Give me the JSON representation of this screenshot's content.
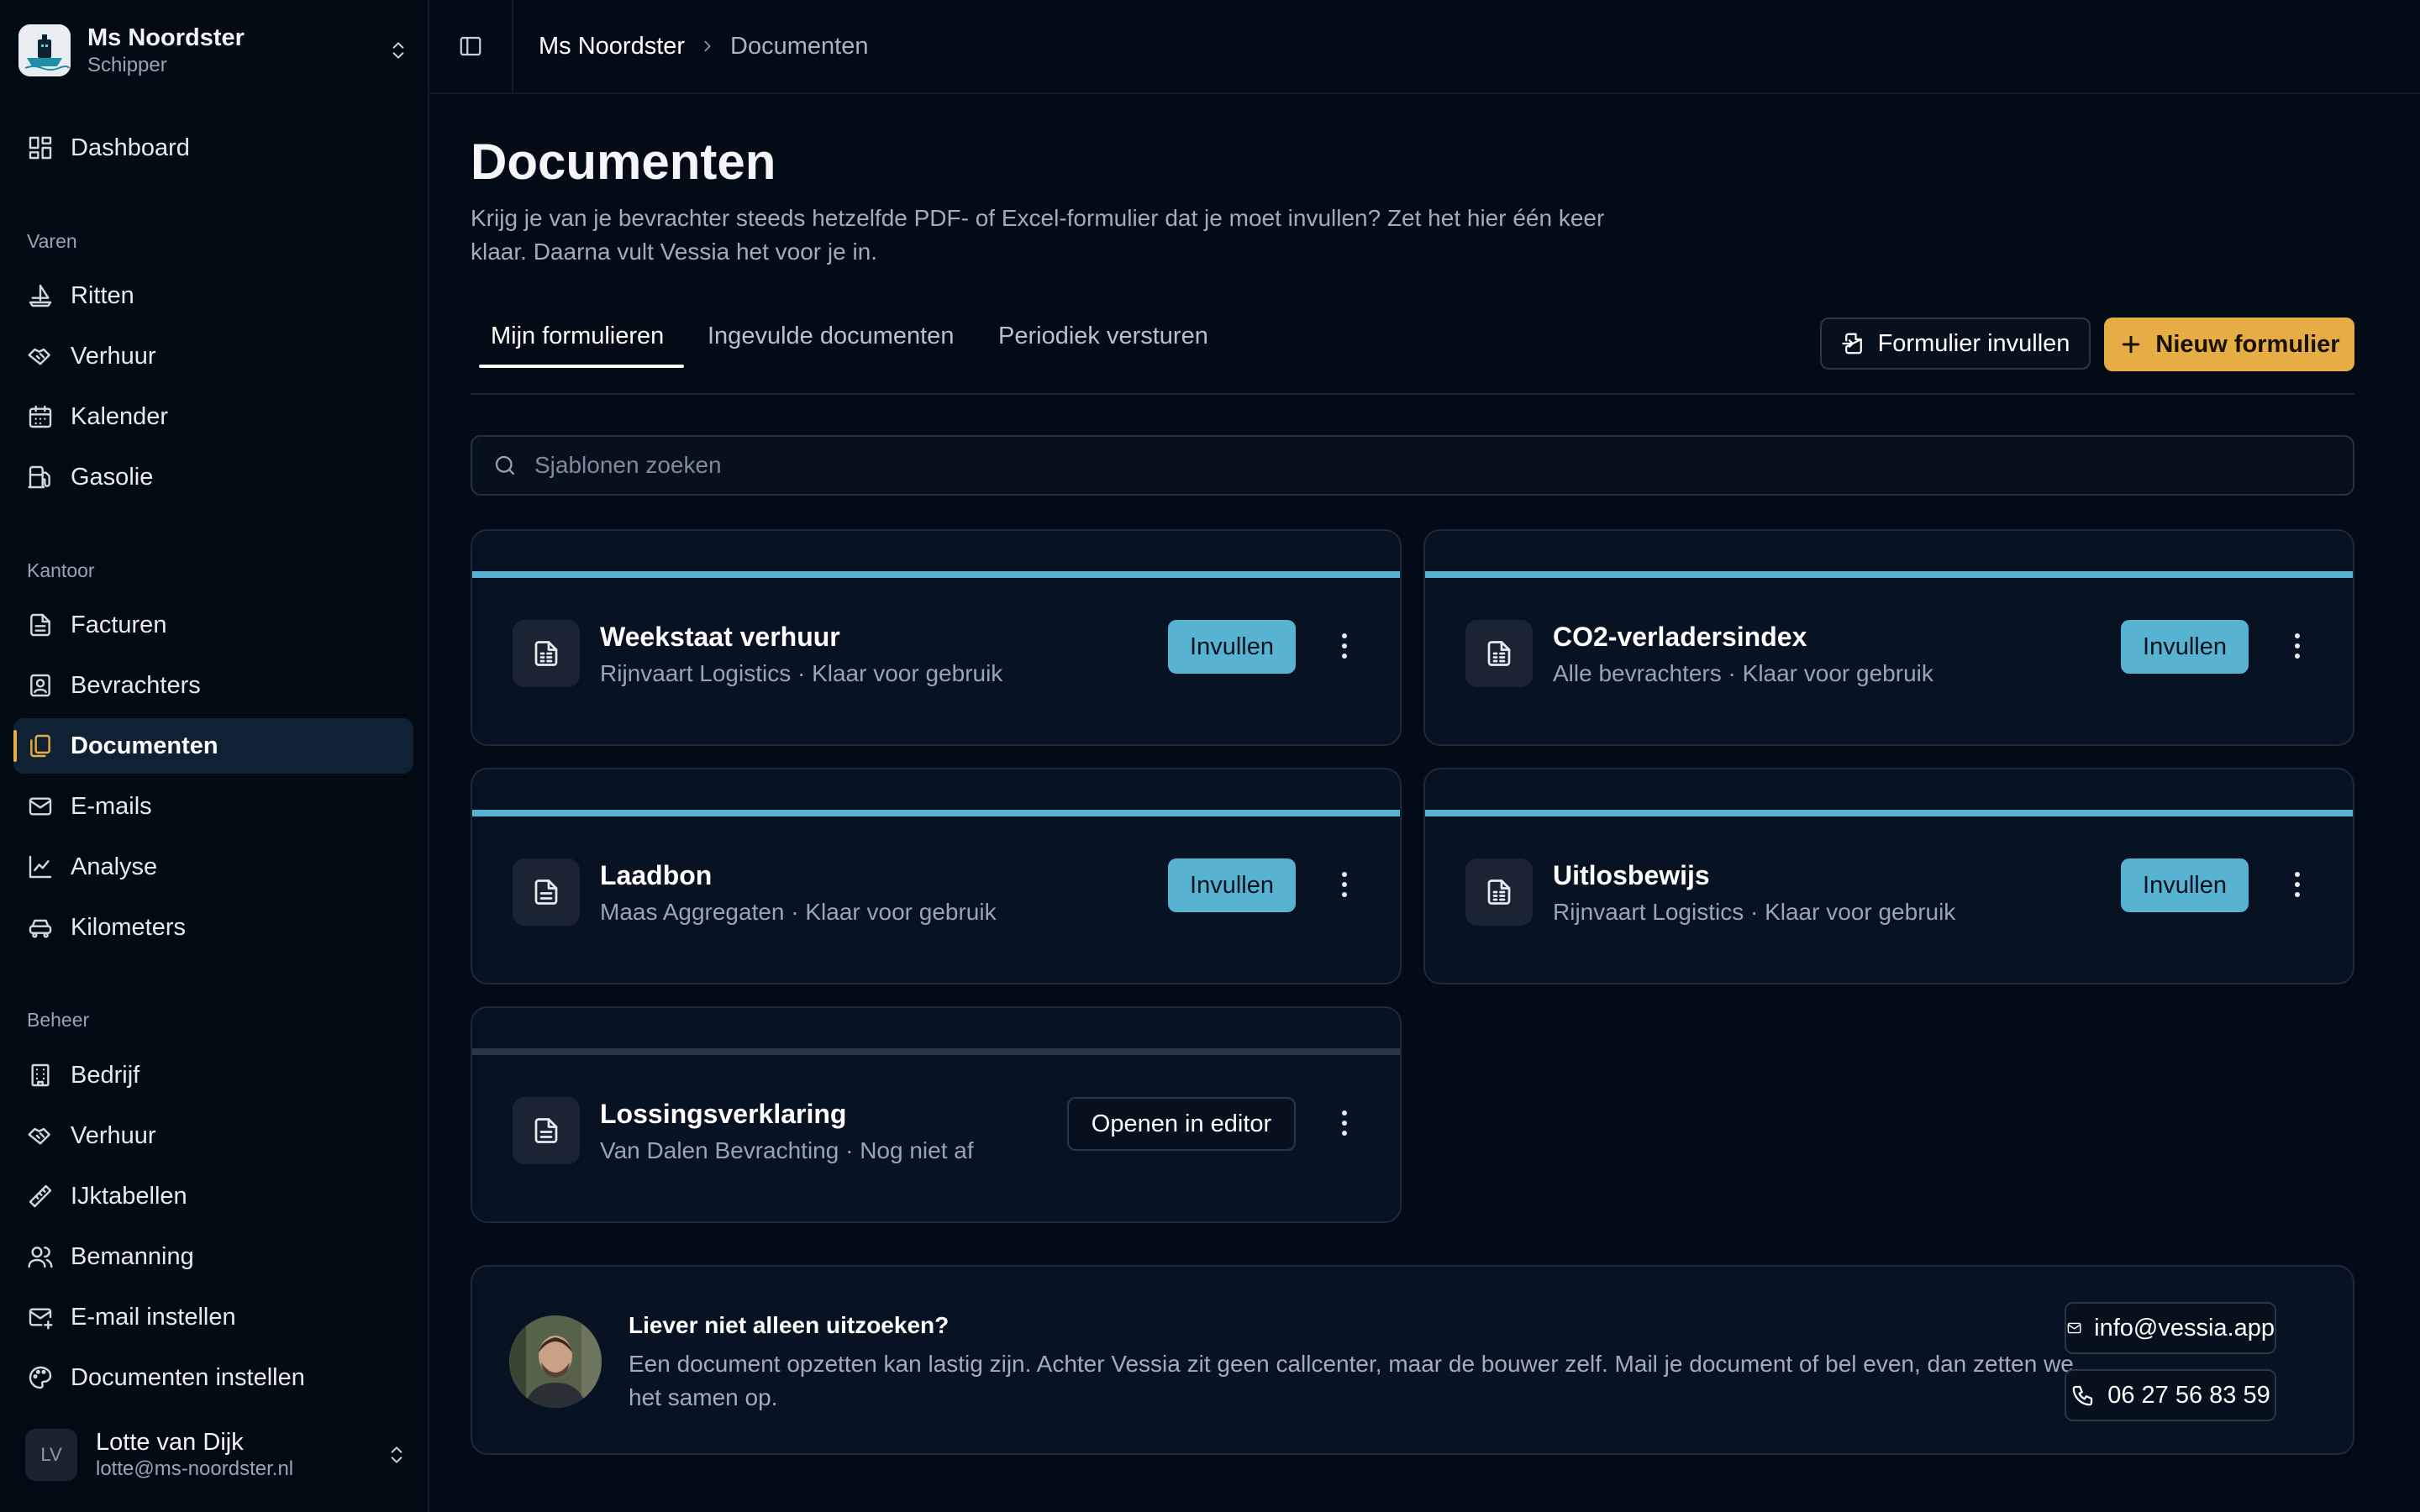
{
  "sidebar": {
    "ship_name": "Ms Noordster",
    "ship_role": "Schipper",
    "dashboard": "Dashboard",
    "sections": {
      "varen": "Varen",
      "kantoor": "Kantoor",
      "beheer": "Beheer"
    },
    "varen_items": [
      "Ritten",
      "Verhuur",
      "Kalender",
      "Gasolie"
    ],
    "kantoor_items": [
      "Facturen",
      "Bevrachters",
      "Documenten",
      "E-mails",
      "Analyse",
      "Kilometers"
    ],
    "beheer_items": [
      "Bedrijf",
      "Verhuur",
      "IJktabellen",
      "Bemanning",
      "E-mail instellen",
      "Documenten instellen"
    ],
    "active_item": "Documenten",
    "accent_color": "#e7ad45",
    "user": {
      "initials": "LV",
      "name": "Lotte van Dijk",
      "email": "lotte@ms-noordster.nl"
    }
  },
  "breadcrumb": {
    "root": "Ms Noordster",
    "current": "Documenten"
  },
  "page": {
    "title": "Documenten",
    "description": "Krijg je van je bevrachter steeds hetzelfde PDF- of Excel-formulier dat je moet invullen? Zet het hier één keer klaar. Daarna vult Vessia het voor je in."
  },
  "tabs": [
    {
      "label": "Mijn formulieren",
      "active": true
    },
    {
      "label": "Ingevulde documenten",
      "active": false
    },
    {
      "label": "Periodiek versturen",
      "active": false
    }
  ],
  "actions": {
    "fill_form": "Formulier invullen",
    "new_form": "Nieuw formulier"
  },
  "search": {
    "placeholder": "Sjablonen zoeken",
    "value": ""
  },
  "templates": [
    {
      "name": "Weekstaat verhuur",
      "meta": "Rijnvaart Logistics · Klaar voor gebruik",
      "action": "Invullen",
      "status": "ready",
      "icon": "spreadsheet-icon"
    },
    {
      "name": "CO2-verladersindex",
      "meta": "Alle bevrachters · Klaar voor gebruik",
      "action": "Invullen",
      "status": "ready",
      "icon": "spreadsheet-icon"
    },
    {
      "name": "Laadbon",
      "meta": "Maas Aggregaten · Klaar voor gebruik",
      "action": "Invullen",
      "status": "ready",
      "icon": "document-icon"
    },
    {
      "name": "Uitlosbewijs",
      "meta": "Rijnvaart Logistics · Klaar voor gebruik",
      "action": "Invullen",
      "status": "ready",
      "icon": "spreadsheet-icon"
    },
    {
      "name": "Lossingsverklaring",
      "meta": "Van Dalen Bevrachting · Nog niet af",
      "action": "Openen in editor",
      "status": "draft",
      "icon": "document-icon"
    }
  ],
  "status_colors": {
    "ready": "#58b2d1",
    "draft": "#2c3745"
  },
  "help": {
    "title": "Liever niet alleen uitzoeken?",
    "text": "Een document opzetten kan lastig zijn. Achter Vessia zit geen callcenter, maar de bouwer zelf. Mail je document of bel even, dan zetten we het samen op.",
    "email": "info@vessia.app",
    "phone": "06 27 56 83 59"
  }
}
